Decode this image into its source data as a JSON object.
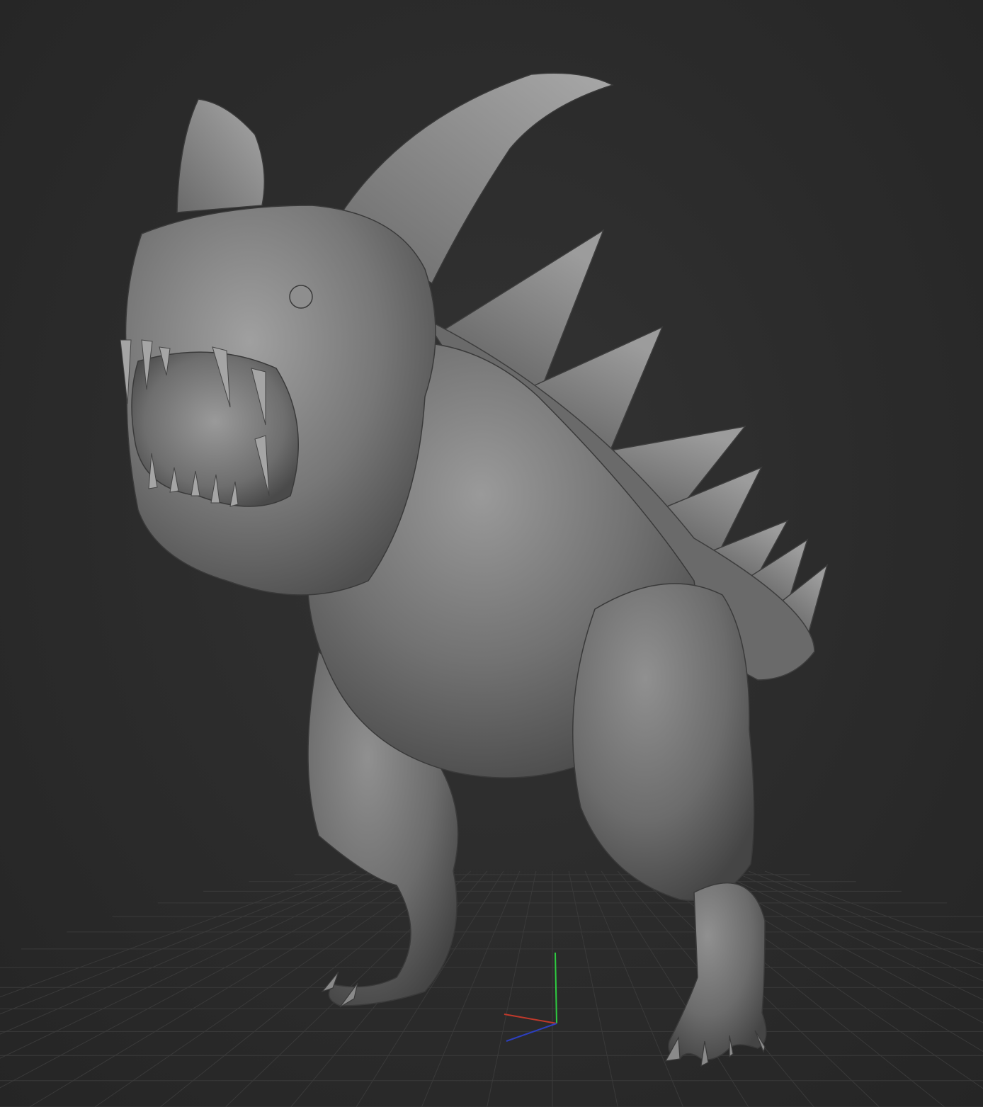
{
  "viewport": {
    "background_color": "#2b2b2b",
    "grid_color": "#3a3a3a",
    "model_base_color": "#7a7a7a",
    "model_highlight_color": "#9a9a9a",
    "model_shadow_color": "#3c3c3c"
  },
  "axis_gizmo": {
    "x_axis_color": "#c0392b",
    "y_axis_color": "#2ecc40",
    "z_axis_color": "#2c3fbf"
  },
  "model": {
    "subject": "sculpted-dinosaur-creature-icon"
  }
}
